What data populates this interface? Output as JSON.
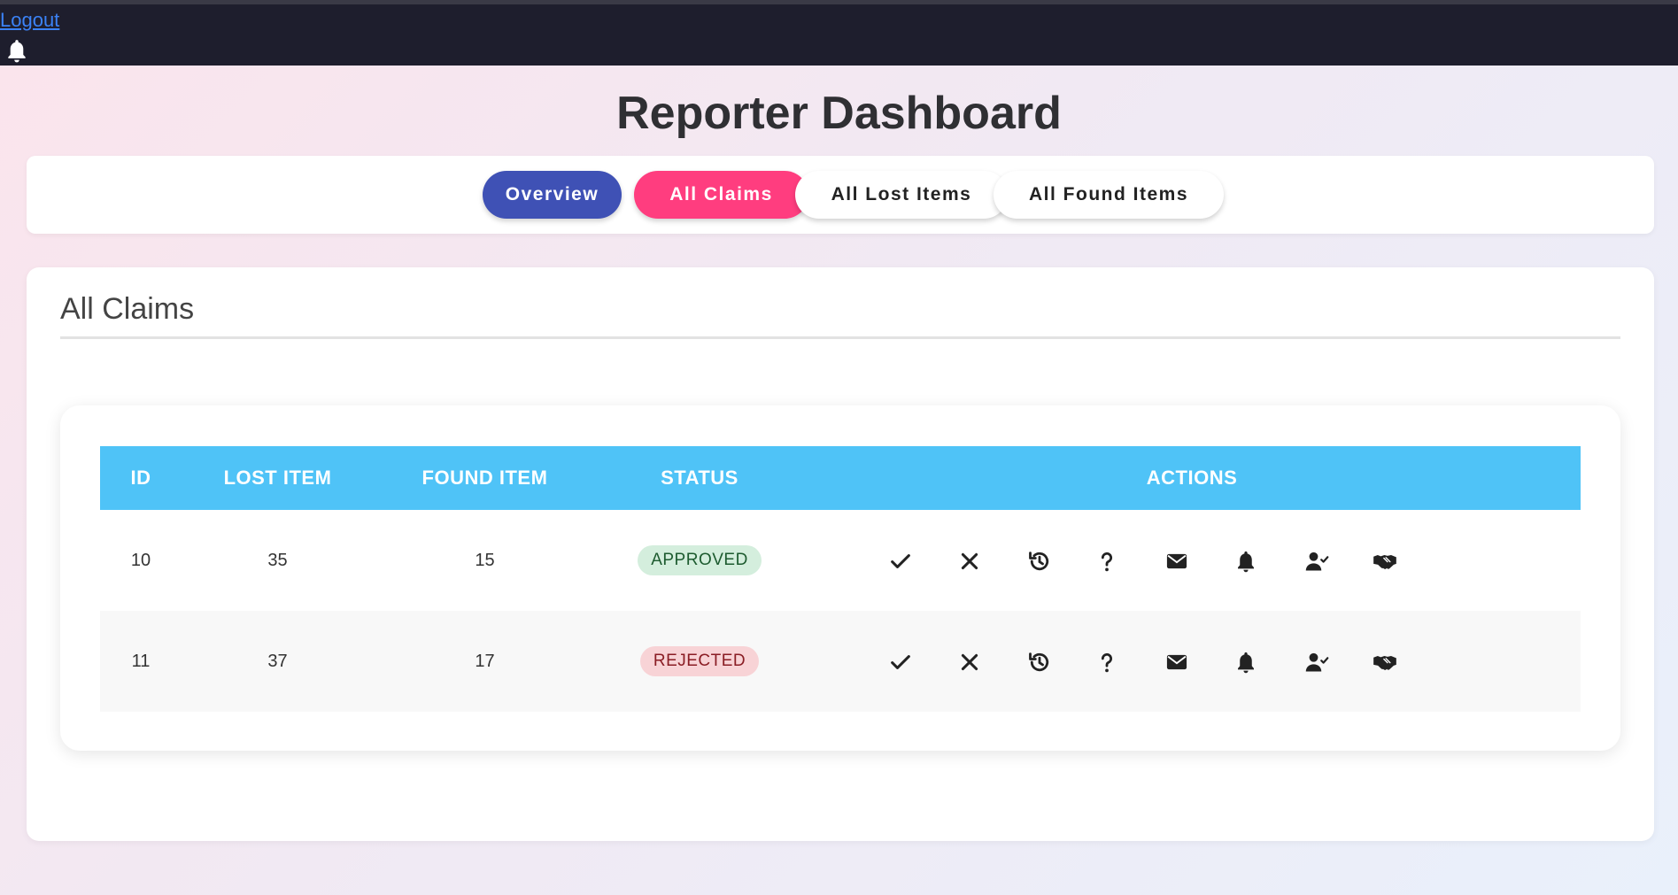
{
  "topbar": {
    "logout_label": "Logout"
  },
  "page": {
    "title": "Reporter Dashboard"
  },
  "tabs": [
    {
      "label": "Overview",
      "active": false,
      "color": "#3f51b5"
    },
    {
      "label": "All Claims",
      "active": true,
      "color": "#ff3d7f"
    },
    {
      "label": "All Lost Items",
      "active": false
    },
    {
      "label": "All Found Items",
      "active": false
    }
  ],
  "section": {
    "title": "All Claims"
  },
  "table": {
    "header_color": "#4fc3f7",
    "columns": [
      "ID",
      "LOST ITEM",
      "FOUND ITEM",
      "STATUS",
      "ACTIONS"
    ],
    "rows": [
      {
        "id": "10",
        "lost_item": "35",
        "found_item": "15",
        "status": "APPROVED"
      },
      {
        "id": "11",
        "lost_item": "37",
        "found_item": "17",
        "status": "REJECTED"
      }
    ]
  },
  "actions": [
    {
      "icon": "check-icon"
    },
    {
      "icon": "close-icon"
    },
    {
      "icon": "history-icon"
    },
    {
      "icon": "question-icon"
    },
    {
      "icon": "envelope-icon"
    },
    {
      "icon": "bell-icon"
    },
    {
      "icon": "user-check-icon"
    },
    {
      "icon": "handshake-icon"
    }
  ]
}
